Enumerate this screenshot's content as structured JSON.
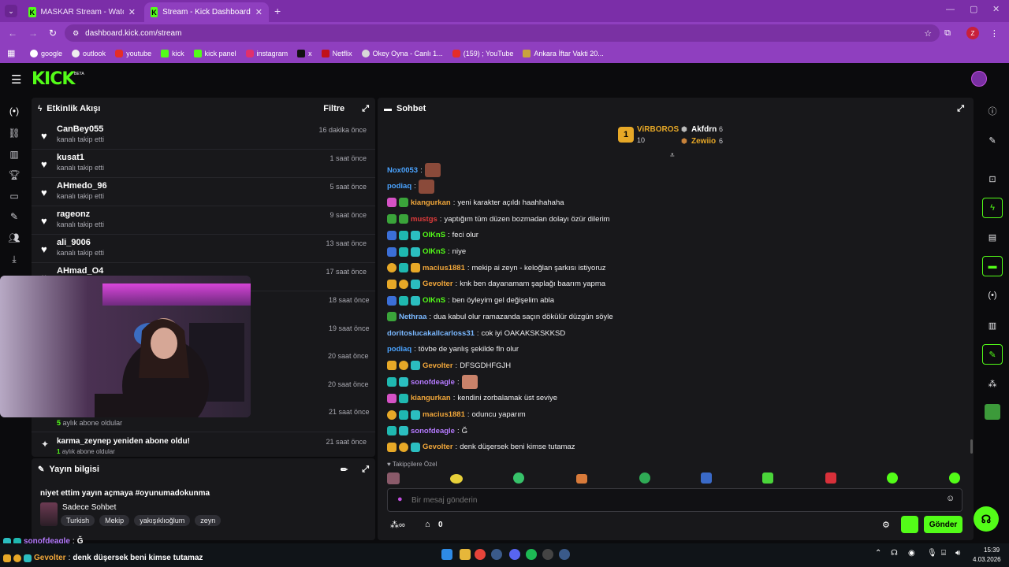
{
  "browser": {
    "tabs": [
      {
        "title": "MASKAR Stream - Watch Live o"
      },
      {
        "title": "Stream - Kick Dashboard"
      }
    ],
    "url": "dashboard.kick.com/stream",
    "bookmarks": [
      "google",
      "outlook",
      "youtube",
      "kick",
      "kick panel",
      "instagram",
      "x",
      "Netflix",
      "Okey Oyna - Canlı 1...",
      "(159) ; YouTube",
      "Ankara İftar Vakti 20..."
    ],
    "profile_initial": "Z"
  },
  "brand": {
    "logo": "KICK",
    "tag": "BETA"
  },
  "activity": {
    "title": "Etkinlik Akışı",
    "filter_label": "Filtre",
    "items": [
      {
        "name": "CanBey055",
        "sub": "kanalı takip etti",
        "time": "16 dakika önce"
      },
      {
        "name": "kusat1",
        "sub": "kanalı takip etti",
        "time": "1 saat önce"
      },
      {
        "name": "AHmedo_96",
        "sub": "kanalı takip etti",
        "time": "5 saat önce"
      },
      {
        "name": "rageonz",
        "sub": "kanalı takip etti",
        "time": "9 saat önce"
      },
      {
        "name": "ali_9006",
        "sub": "kanalı takip etti",
        "time": "13 saat önce"
      },
      {
        "name": "AHmad_O4",
        "sub": "",
        "time": "17 saat önce"
      }
    ],
    "hidden_times": [
      "18 saat önce",
      "19 saat önce",
      "20 saat önce",
      "20 saat önce",
      "21 saat önce"
    ],
    "sub_months_number": "5",
    "sub_months_text": "aylık abone oldular",
    "resub_text": "karma_zeynep yeniden abone oldu!",
    "resub_time": "21 saat önce",
    "resub_months_number": "1",
    "resub_months_text": "aylık abone oldular"
  },
  "stream_info": {
    "title": "Yayın bilgisi",
    "stream_title": "niyet ettim yayın açmaya #oyunumadokunma",
    "category": "Sadece Sohbet",
    "tags": [
      "Turkish",
      "Mekip",
      "yakışıklıoğlum",
      "zeyn"
    ]
  },
  "chat": {
    "title": "Sohbet",
    "leaderboard": [
      {
        "rank": "1",
        "name": "ViRBOROS",
        "count": "10"
      },
      {
        "name": "Akfdrn",
        "count": "6"
      },
      {
        "name": "Zewiio",
        "count": "6"
      }
    ],
    "messages": [
      {
        "user": "Nox0053",
        "color": "#4aa3ff",
        "text": "",
        "badges": []
      },
      {
        "user": "podiaq",
        "color": "#4aa3ff",
        "text": "",
        "badges": []
      },
      {
        "user": "kiangurkan",
        "color": "#f0a63a",
        "text": "yeni karakter açıldı haahhahaha",
        "badges": [
          "pink",
          "green"
        ]
      },
      {
        "user": "mustgs",
        "color": "#e03b3b",
        "text": "yaptığım tüm düzen bozmadan dolayı özür dilerim",
        "badges": [
          "green",
          "green"
        ]
      },
      {
        "user": "OlKnS",
        "color": "#53fc18",
        "text": "feci olur",
        "badges": [
          "blue",
          "sub",
          "vip"
        ]
      },
      {
        "user": "OlKnS",
        "color": "#53fc18",
        "text": "niye",
        "badges": [
          "blue",
          "sub",
          "vip"
        ]
      },
      {
        "user": "macius1881",
        "color": "#f0a63a",
        "text": "mekip ai zeyn - keloğlan şarkısı istiyoruz",
        "badges": [
          "gold",
          "sub",
          "crown"
        ]
      },
      {
        "user": "Gevolter",
        "color": "#f0a63a",
        "text": "knk ben dayanamam şaplağı baarım yapma",
        "badges": [
          "crown",
          "gold",
          "vip"
        ]
      },
      {
        "user": "OlKnS",
        "color": "#53fc18",
        "text": "ben öyleyim gel değişelim abla",
        "badges": [
          "blue",
          "sub",
          "vip"
        ]
      },
      {
        "user": "Nethraa",
        "color": "#7ab8ff",
        "text": "dua kabul olur ramazanda saçın dökülür düzgün söyle",
        "badges": [
          "green"
        ]
      },
      {
        "user": "doritoslucakallcarloss31",
        "color": "#7ab8ff",
        "text": "cok iyi OAKAKSKSKKSD",
        "badges": []
      },
      {
        "user": "podiaq",
        "color": "#4aa3ff",
        "text": "tövbe de yanlış şekilde fln olur",
        "badges": []
      },
      {
        "user": "Gevolter",
        "color": "#f0a63a",
        "text": "DFSGDHFGJH",
        "badges": [
          "crown",
          "gold",
          "vip"
        ]
      },
      {
        "user": "sonofdeagle",
        "color": "#b57aff",
        "text": "",
        "badges": [
          "sub",
          "vip"
        ]
      },
      {
        "user": "kiangurkan",
        "color": "#f0a63a",
        "text": "kendini zorbalamak üst seviye",
        "badges": [
          "pink",
          "sub"
        ]
      },
      {
        "user": "macius1881",
        "color": "#f0a63a",
        "text": "oduncu yaparım",
        "badges": [
          "gold",
          "sub",
          "vip"
        ]
      },
      {
        "user": "sonofdeagle",
        "color": "#b57aff",
        "text": "Ğ",
        "badges": [
          "sub",
          "vip"
        ]
      },
      {
        "user": "Gevolter",
        "color": "#f0a63a",
        "text": "denk düşersek beni kimse tutamaz",
        "badges": [
          "crown",
          "gold",
          "vip"
        ]
      }
    ],
    "followers_only": "Takipçilere Özel",
    "input_placeholder": "Bir mesaj gönderin",
    "counter": "0",
    "send_label": "Gönder"
  },
  "overlay": [
    {
      "user": "sonofdeagle",
      "text": "Ğ"
    },
    {
      "user": "Gevolter",
      "text": "denk düşersek beni kimse tutamaz"
    }
  ],
  "taskbar": {
    "time": "15:39",
    "date": "4.03.2026"
  },
  "colors": {
    "accent": "#53fc18",
    "browser": "#8f3fbf",
    "panel": "#18181b"
  }
}
